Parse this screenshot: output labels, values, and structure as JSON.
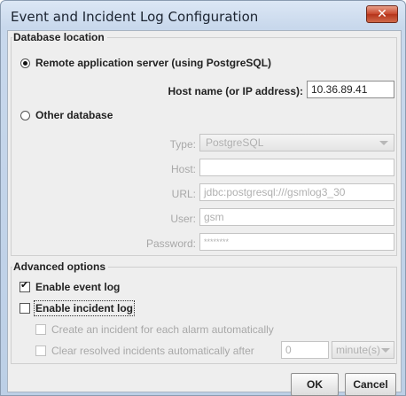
{
  "window": {
    "title": "Event and Incident Log Configuration",
    "close_symbol": "✕"
  },
  "database_location": {
    "legend": "Database location",
    "remote_option": {
      "label": "Remote application server (using PostgreSQL)",
      "selected": true
    },
    "host_label": "Host name (or IP address):",
    "host_value": "10.36.89.41",
    "other_option": {
      "label": "Other database",
      "selected": false
    },
    "type_label": "Type:",
    "type_value": "PostgreSQL",
    "host2_label": "Host:",
    "host2_value": "",
    "url_label": "URL:",
    "url_value": "jdbc:postgresql:///gsmlog3_30",
    "user_label": "User:",
    "user_value": "gsm",
    "password_label": "Password:",
    "password_value": "********"
  },
  "advanced_options": {
    "legend": "Advanced options",
    "event_log": {
      "label": "Enable event log",
      "checked": true
    },
    "incident_log": {
      "label": "Enable incident log",
      "checked": false
    },
    "create_incident": {
      "label": "Create an incident for each alarm automatically",
      "checked": false
    },
    "clear_resolved": {
      "label": "Clear resolved incidents automatically after",
      "checked": false
    },
    "clear_after_value": "0",
    "clear_after_unit": "minute(s)"
  },
  "buttons": {
    "ok": "OK",
    "cancel": "Cancel"
  },
  "icons": {
    "check_mark": "✔"
  }
}
